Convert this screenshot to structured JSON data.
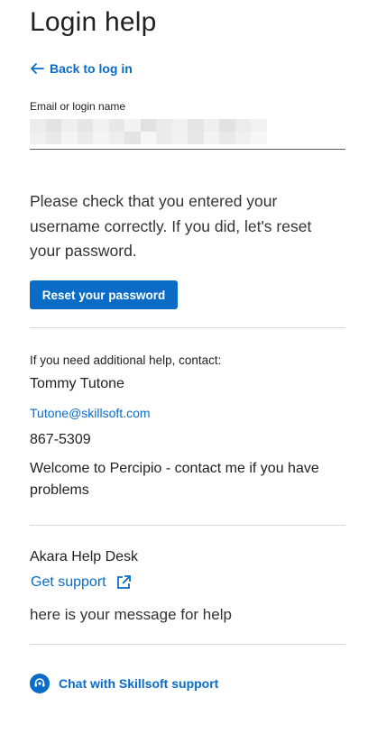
{
  "page": {
    "title": "Login help"
  },
  "nav": {
    "back_label": "Back to log in"
  },
  "login_field": {
    "label": "Email or login name",
    "value_redacted": true
  },
  "message": "Please check that you entered your username correctly. If you did, let's reset your password.",
  "reset_button_label": "Reset your password",
  "contact": {
    "intro": "If you need additional help, contact:",
    "name": "Tommy Tutone",
    "email": "Tutone@skillsoft.com",
    "phone": "867-5309",
    "note": "Welcome to Percipio - contact me if you have problems"
  },
  "help_desk": {
    "name": "Akara Help Desk",
    "support_link_label": "Get support",
    "message": "here is your message for help"
  },
  "chat": {
    "label": "Chat with Skillsoft support"
  },
  "colors": {
    "accent": "#0a6cc7",
    "text": "#222222",
    "divider": "#d6d6d6"
  },
  "icons": {
    "back": "arrow-left-icon",
    "external": "external-link-icon",
    "chat": "chat-headset-icon"
  }
}
